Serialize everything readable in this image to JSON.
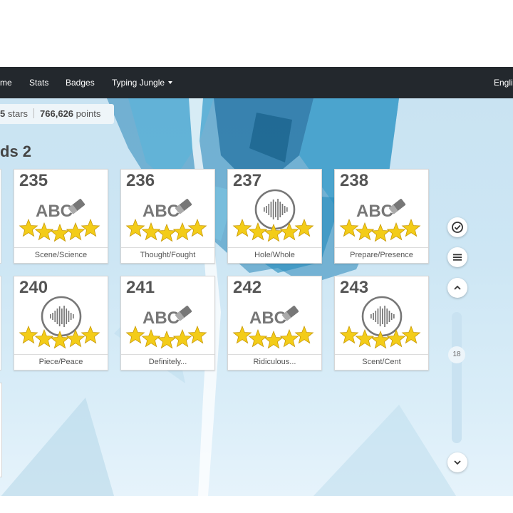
{
  "nav": {
    "items": [
      {
        "label": "me"
      },
      {
        "label": "Stats"
      },
      {
        "label": "Badges"
      },
      {
        "label": "Typing Jungle"
      }
    ],
    "language": "Engli"
  },
  "stats": {
    "stars_value": "5",
    "stars_unit": "stars",
    "points_value": "766,626",
    "points_unit": "points"
  },
  "section": {
    "title": "ds 2"
  },
  "lessons": [
    {
      "number": "235",
      "label": "Scene/Science",
      "icon": "abc-eraser-icon",
      "stars": 5
    },
    {
      "number": "236",
      "label": "Thought/Fought",
      "icon": "abc-eraser-icon",
      "stars": 5
    },
    {
      "number": "237",
      "label": "Hole/Whole",
      "icon": "audio-waveform-icon",
      "stars": 5
    },
    {
      "number": "238",
      "label": "Prepare/Presence",
      "icon": "abc-eraser-icon",
      "stars": 5
    },
    {
      "number": "240",
      "label": "Piece/Peace",
      "icon": "audio-waveform-icon",
      "stars": 5
    },
    {
      "number": "241",
      "label": "Definitely...",
      "icon": "abc-eraser-icon",
      "stars": 5
    },
    {
      "number": "242",
      "label": "Ridiculous...",
      "icon": "abc-eraser-icon",
      "stars": 5
    },
    {
      "number": "243",
      "label": "Scent/Cent",
      "icon": "audio-waveform-icon",
      "stars": 5
    }
  ],
  "sidebar": {
    "check_icon": "check-circle-icon",
    "menu_icon": "hamburger-menu-icon",
    "up_icon": "chevron-up-icon",
    "down_icon": "chevron-down-icon",
    "scroll_value": "18"
  },
  "colors": {
    "navbar": "#23282d",
    "star": "#f3cc18",
    "icon_gray": "#777777"
  }
}
